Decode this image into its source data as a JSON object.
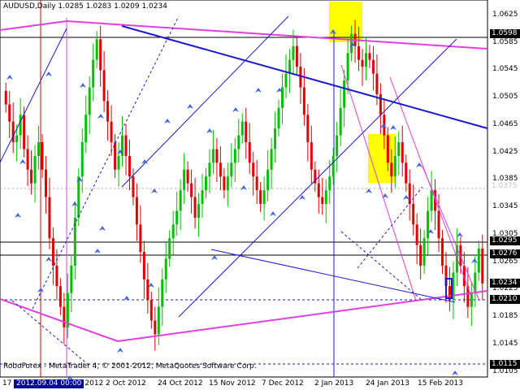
{
  "window": {
    "symbol_title": "AUDUSD,Daily  1.0285 1.0283 1.0209 1.0234",
    "copyright": "RoboForex - MetaTrader 4, © 2001-2012, MetaQuotes Software Corp.",
    "crosshair_label": "2012.09.04 00:00"
  },
  "colors": {
    "bull": "#00c000",
    "bear": "#e00000",
    "trendline_blue": "#1a1acc",
    "channel_magenta": "#e040e0",
    "highlight_yellow": "#ffff00",
    "arrow_blue": "#4060e0"
  },
  "price_axis": {
    "ticks": [
      "1.0625",
      "1.0585",
      "1.0545",
      "1.0505",
      "1.0465",
      "1.0425",
      "1.0385",
      "1.0345",
      "1.0305",
      "1.0265",
      "1.0225",
      "1.0185",
      "1.0145",
      "1.0105"
    ],
    "marked": [
      {
        "value": "1.0598",
        "style": "dark"
      },
      {
        "value": "1.0375",
        "style": "faint"
      },
      {
        "value": "1.0295",
        "style": "dark"
      },
      {
        "value": "1.0276",
        "style": "dark"
      },
      {
        "value": "1.0234",
        "style": "dark"
      },
      {
        "value": "1.0210",
        "style": "dark"
      },
      {
        "value": "1.0115",
        "style": "dark"
      }
    ]
  },
  "time_axis": {
    "labels": [
      "17",
      "2012.09.04 00:00",
      "Oct 2012",
      "2 Oct 2012",
      "24 Oct 2012",
      "15 Nov 2012",
      "7 Dec 2012",
      "2 Jan 2013",
      "24 Jan 2013",
      "15 Feb 2013"
    ]
  },
  "chart_data": {
    "type": "candlestick",
    "symbol": "AUDUSD",
    "timeframe": "Daily",
    "last_bar": {
      "open": 1.0285,
      "high": 1.0283,
      "low": 1.0209,
      "close": 1.0234
    },
    "ylim": [
      1.01,
      1.0645
    ],
    "horizontal_levels": [
      1.0598,
      1.0295,
      1.0276,
      1.021,
      1.0115
    ],
    "closes": [
      1.0495,
      1.047,
      1.044,
      1.045,
      1.048,
      1.043,
      1.04,
      1.038,
      1.042,
      1.044,
      1.04,
      1.036,
      1.03,
      1.026,
      1.023,
      1.02,
      1.017,
      1.022,
      1.026,
      1.033,
      1.039,
      1.044,
      1.048,
      1.052,
      1.056,
      1.059,
      1.0545,
      1.05,
      1.047,
      1.044,
      1.04,
      1.042,
      1.045,
      1.042,
      1.039,
      1.036,
      1.032,
      1.028,
      1.024,
      1.021,
      1.018,
      1.016,
      1.02,
      1.024,
      1.027,
      1.03,
      1.032,
      1.034,
      1.037,
      1.04,
      1.038,
      1.036,
      1.033,
      1.035,
      1.037,
      1.039,
      1.041,
      1.043,
      1.041,
      1.039,
      1.037,
      1.039,
      1.041,
      1.043,
      1.045,
      1.047,
      1.044,
      1.041,
      1.039,
      1.037,
      1.035,
      1.037,
      1.04,
      1.043,
      1.046,
      1.049,
      1.052,
      1.054,
      1.056,
      1.058,
      1.055,
      1.052,
      1.048,
      1.044,
      1.04,
      1.038,
      1.036,
      1.035,
      1.037,
      1.039,
      1.042,
      1.045,
      1.049,
      1.053,
      1.057,
      1.0598,
      1.058,
      1.056,
      1.055,
      1.057,
      1.056,
      1.054,
      1.051,
      1.048,
      1.045,
      1.041,
      1.039,
      1.042,
      1.044,
      1.041,
      1.038,
      1.035,
      1.032,
      1.029,
      1.026,
      1.03,
      1.034,
      1.037,
      1.034,
      1.03,
      1.026,
      1.023,
      1.021,
      1.025,
      1.029,
      1.026,
      1.023,
      1.02,
      1.022,
      1.025,
      1.0285,
      1.0234
    ]
  }
}
